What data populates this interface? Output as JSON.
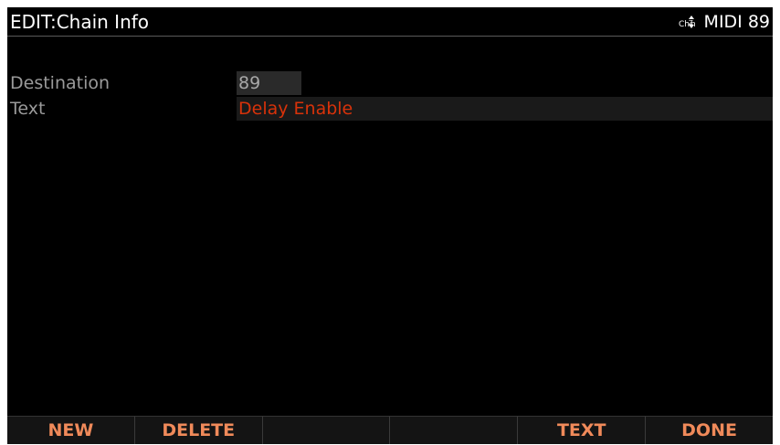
{
  "header": {
    "title": "EDIT:Chain Info",
    "chain_icon": "chzn-updown-icon",
    "chain_icon_text": "ChZn",
    "midi_label": "MIDI 89"
  },
  "fields": [
    {
      "label": "Destination",
      "value": "89"
    },
    {
      "label": "Text",
      "value": "Delay Enable"
    }
  ],
  "softkeys": [
    "NEW",
    "DELETE",
    "",
    "",
    "TEXT",
    "DONE"
  ],
  "colors": {
    "screen_bg": "#000000",
    "label": "#9a9a9a",
    "text_value": "#d8320a",
    "softkey_text": "#f08a5a"
  }
}
